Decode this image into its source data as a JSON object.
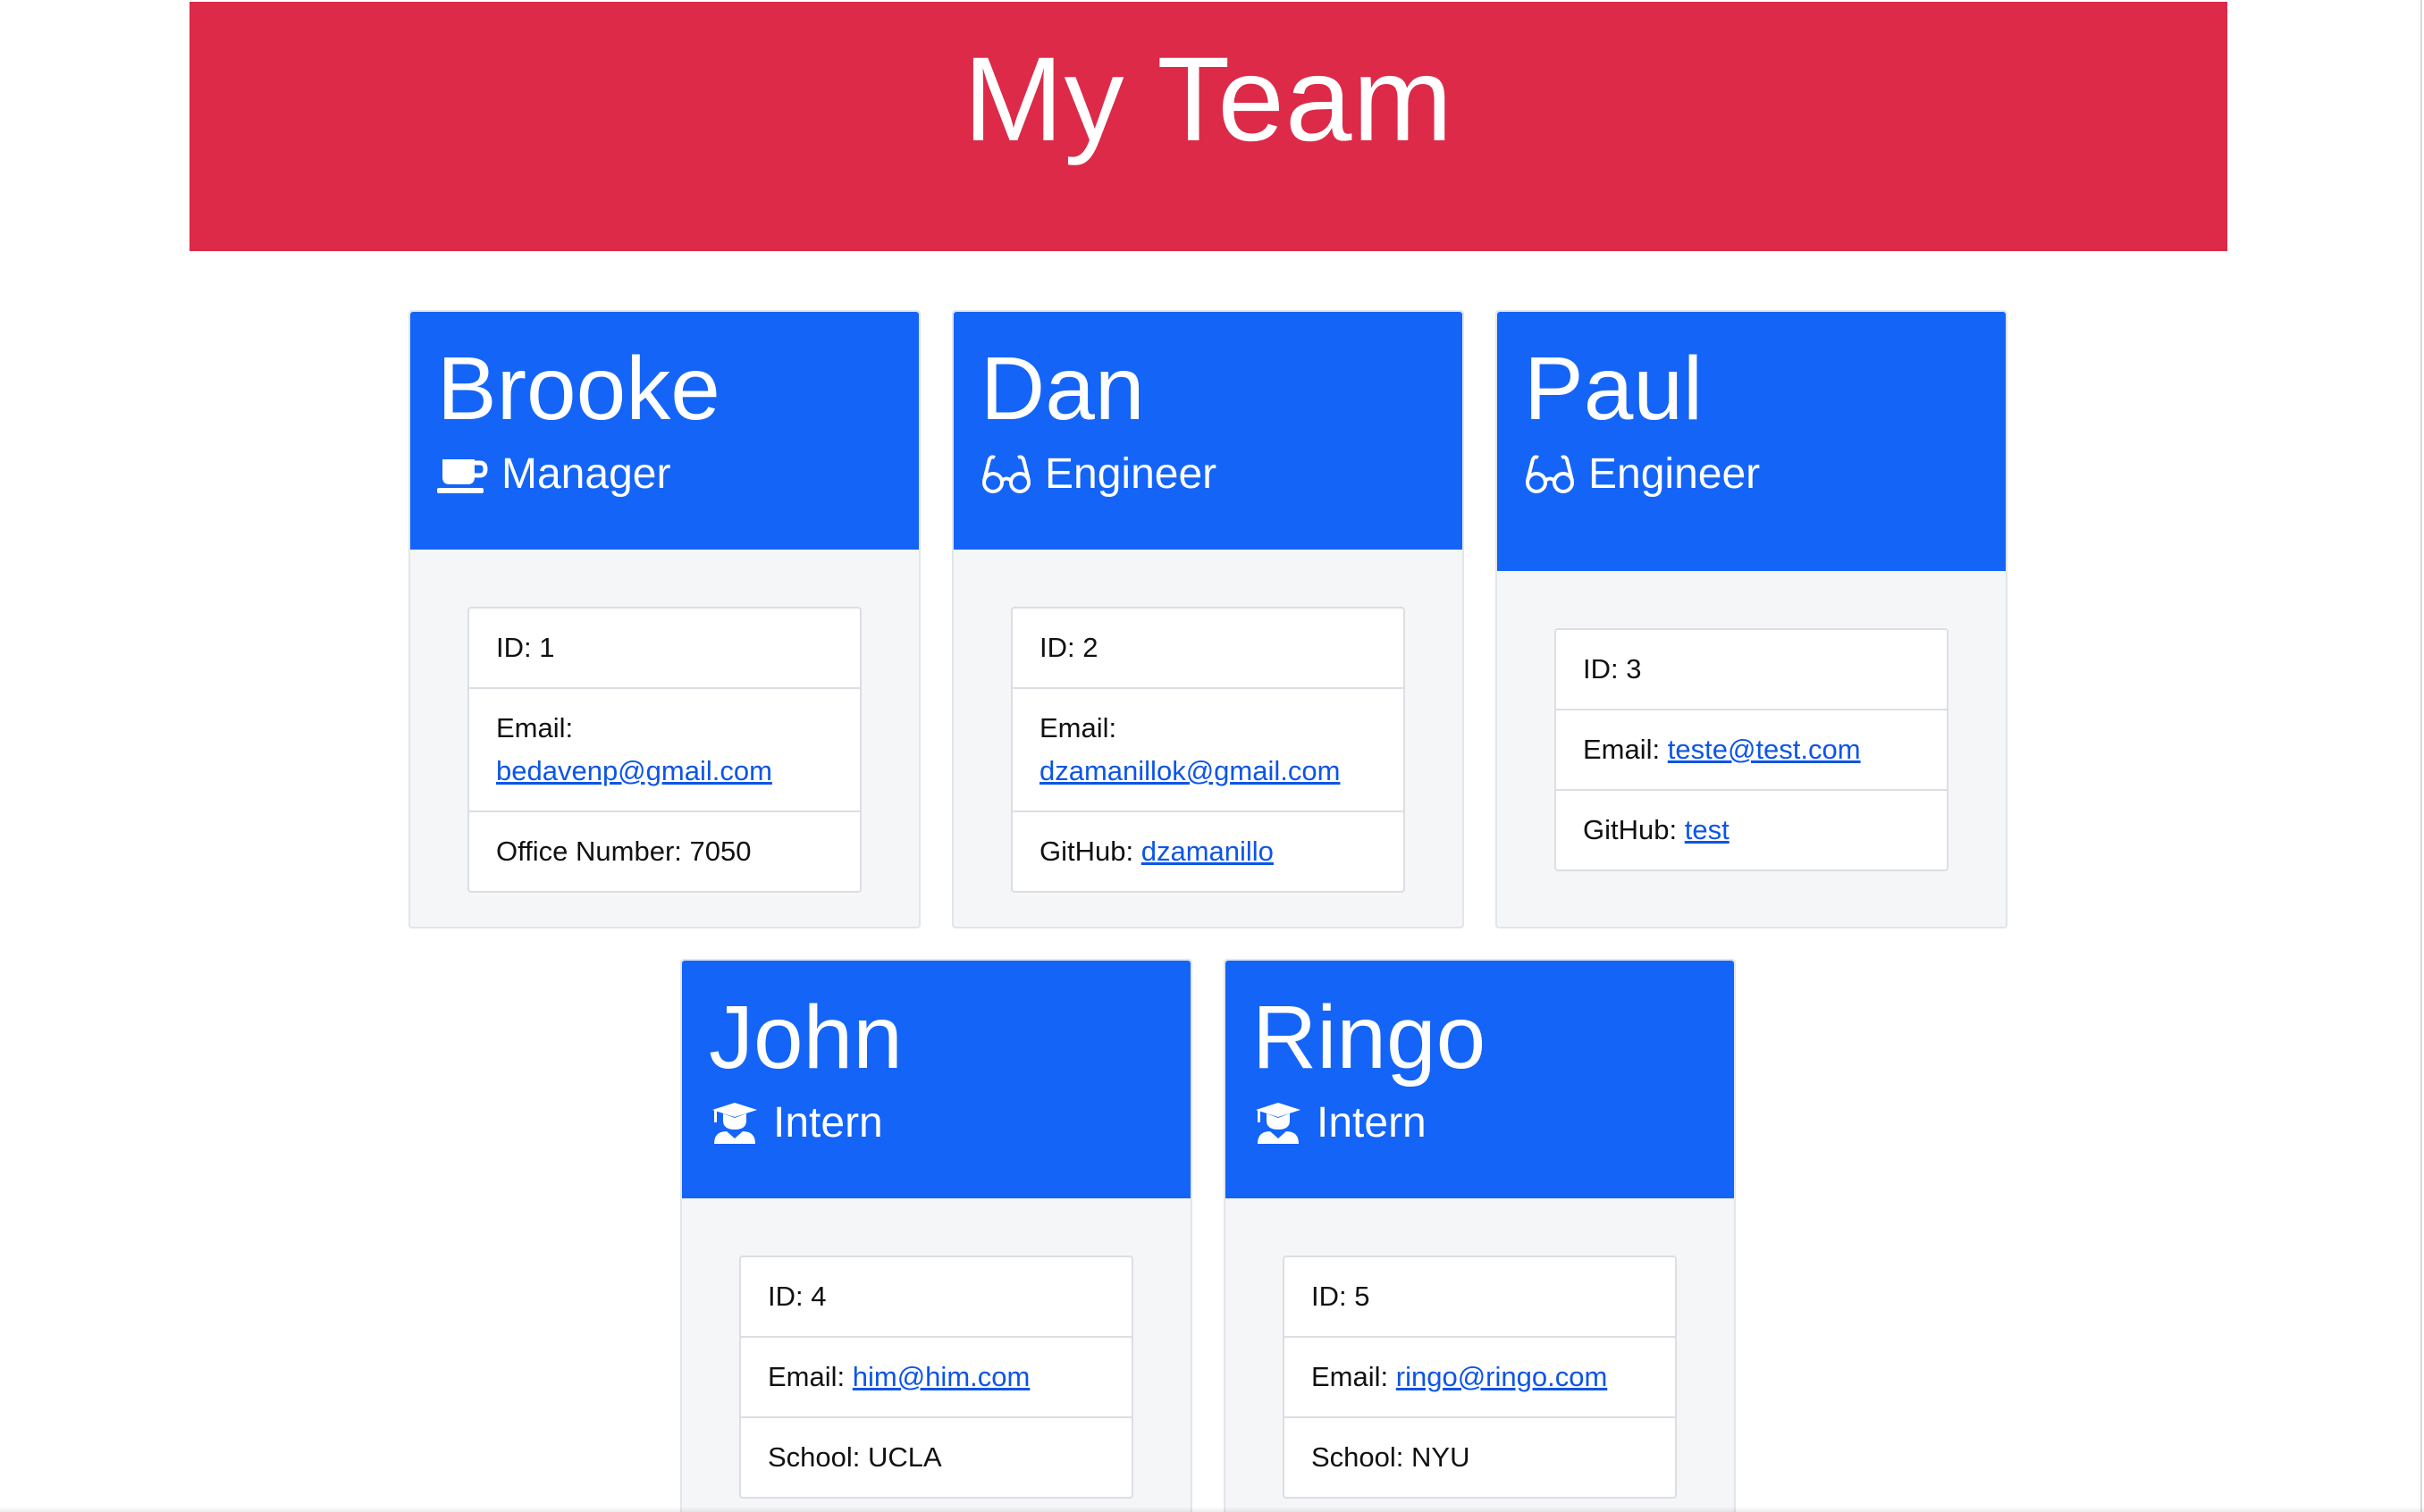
{
  "header": {
    "title": "My Team"
  },
  "colors": {
    "header_bg": "#dc2a48",
    "card_header_bg": "#1464f7",
    "link": "#0d55e6"
  },
  "employees": [
    {
      "name": "Brooke",
      "role": "Manager",
      "icon": "mug-icon",
      "id_line": "ID: 1",
      "email_label": "Email:",
      "email": "bedavenp@gmail.com",
      "extra_label": "Office Number: 7050",
      "extra_link": ""
    },
    {
      "name": "Dan",
      "role": "Engineer",
      "icon": "glasses-icon",
      "id_line": "ID: 2",
      "email_label": "Email:",
      "email": "dzamanillok@gmail.com",
      "extra_label": "GitHub:",
      "extra_link": "dzamanillo"
    },
    {
      "name": "Paul",
      "role": "Engineer",
      "icon": "glasses-icon",
      "id_line": "ID: 3",
      "email_label": "Email:",
      "email": "teste@test.com",
      "extra_label": "GitHub:",
      "extra_link": "test"
    },
    {
      "name": "John",
      "role": "Intern",
      "icon": "graduate-icon",
      "id_line": "ID: 4",
      "email_label": "Email:",
      "email": "him@him.com",
      "extra_label": "School: UCLA",
      "extra_link": ""
    },
    {
      "name": "Ringo",
      "role": "Intern",
      "icon": "graduate-icon",
      "id_line": "ID: 5",
      "email_label": "Email:",
      "email": "ringo@ringo.com",
      "extra_label": "School: NYU",
      "extra_link": ""
    }
  ]
}
